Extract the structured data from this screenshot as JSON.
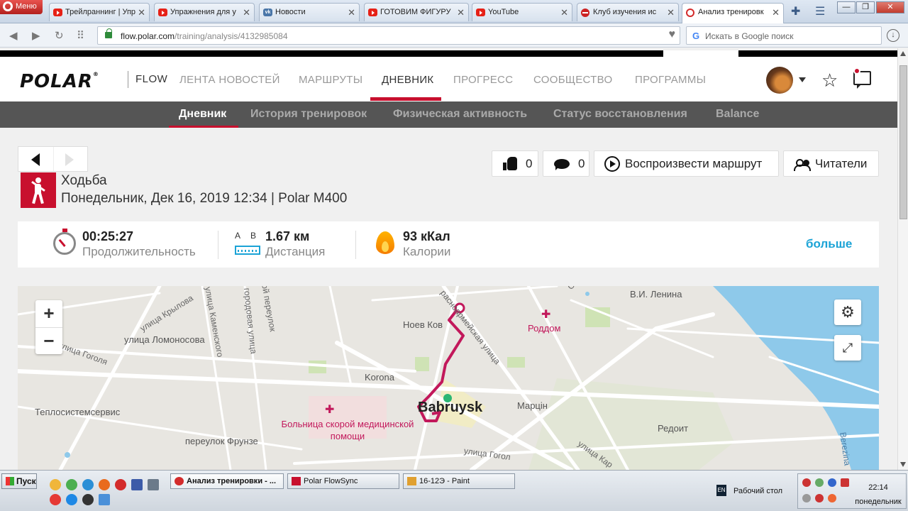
{
  "browser": {
    "menu_label": "Меню",
    "tabs": [
      {
        "label": "Трейлраннинг | Упр",
        "icon": "youtube-icon"
      },
      {
        "label": "Упражнения для у",
        "icon": "youtube-icon"
      },
      {
        "label": "Новости",
        "icon": "vk-icon"
      },
      {
        "label": "ГОТОВИМ ФИГУРУ",
        "icon": "youtube-icon"
      },
      {
        "label": "YouTube",
        "icon": "youtube-icon"
      },
      {
        "label": "Клуб изучения ис",
        "icon": "club-icon"
      },
      {
        "label": "Анализ тренировк",
        "icon": "opera-icon"
      }
    ],
    "url_domain": "flow.polar.com",
    "url_path": "/training/analysis/4132985084",
    "url_scheme": "",
    "search_placeholder": "Искать в Google поиск"
  },
  "header": {
    "logo": "POLAR",
    "logo_mark": "®",
    "product": "FLOW",
    "nav": [
      {
        "label": "ЛЕНТА НОВОСТЕЙ"
      },
      {
        "label": "МАРШРУТЫ"
      },
      {
        "label": "ДНЕВНИК"
      },
      {
        "label": "ПРОГРЕСС"
      },
      {
        "label": "СООБЩЕСТВО"
      },
      {
        "label": "ПРОГРАММЫ"
      }
    ]
  },
  "subnav": [
    {
      "label": "Дневник"
    },
    {
      "label": "История тренировок"
    },
    {
      "label": "Физическая активность"
    },
    {
      "label": "Статус восстановления"
    },
    {
      "label": "Balance"
    }
  ],
  "actions": {
    "likes": "0",
    "comments": "0",
    "replay_label": "Воспроизвести маршрут",
    "followers_label": "Читатели"
  },
  "session": {
    "sport": "Ходьба",
    "meta": "Понедельник, Дек 16, 2019 12:34 | Polar M400"
  },
  "stats": {
    "duration_value": "00:25:27",
    "duration_label": "Продолжительность",
    "distance_value": "1.67 км",
    "distance_label": "Дистанция",
    "distance_a": "A",
    "distance_b": "B",
    "calories_value": "93 кКал",
    "calories_label": "Калории",
    "more_label": "больше"
  },
  "map": {
    "zoom_in": "+",
    "zoom_out": "−",
    "labels": {
      "krylova": "улица Крылова",
      "kamenskogo": "улица Каменского",
      "gorodovaya": "городовая улица",
      "pereulok": "ой переулок",
      "lomonosova": "улица Ломоносова",
      "gogolya": "улица Гоголя",
      "teplo": "Теплосистемсервис",
      "frunze": "переулок Фрунзе",
      "hospital": "Больница скорой медицинской помощи",
      "korona": "Korona",
      "noev": "Ноев Ков",
      "armeiskaya": "расноармейская улица",
      "roddom": "Роддом",
      "lenina": "В.И. Ленина",
      "city": "Babruysk",
      "marcin": "Марцін",
      "redoit": "Редоит",
      "gogolya2": "улица Гогол",
      "kar": "улица Кар",
      "berezina": "Berezina",
      "s": "С"
    }
  },
  "taskbar": {
    "start": "Пуск",
    "windows": [
      {
        "label": "Анализ тренировки - ..."
      },
      {
        "label": "Polar FlowSync"
      },
      {
        "label": "16-12Э - Paint"
      }
    ],
    "desktop": "Рабочий стол",
    "lang": "EN",
    "time": "22:14",
    "day": "понедельник"
  }
}
